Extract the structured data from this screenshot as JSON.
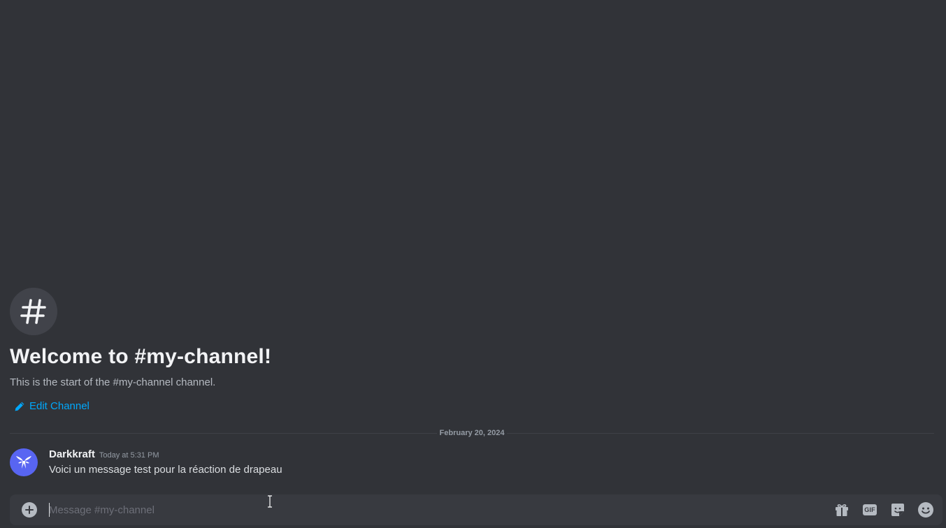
{
  "channel": {
    "welcome_title": "Welcome to #my-channel!",
    "welcome_subtitle": "This is the start of the #my-channel channel.",
    "edit_label": "Edit Channel",
    "hash_icon": "hash-icon"
  },
  "divider": {
    "date": "February 20, 2024"
  },
  "message": {
    "username": "Darkkraft",
    "timestamp": "Today at 5:31 PM",
    "text": "Voici un message test pour la réaction de drapeau"
  },
  "composer": {
    "placeholder": "Message #my-channel",
    "gif_label": "GIF",
    "icons": [
      "plus-circle-icon",
      "gift-icon",
      "gif-icon",
      "sticker-icon",
      "emoji-icon"
    ]
  },
  "colors": {
    "background": "#313338",
    "composer_bg": "#383a40",
    "link": "#00a8fc",
    "avatar": "#5865f2"
  }
}
